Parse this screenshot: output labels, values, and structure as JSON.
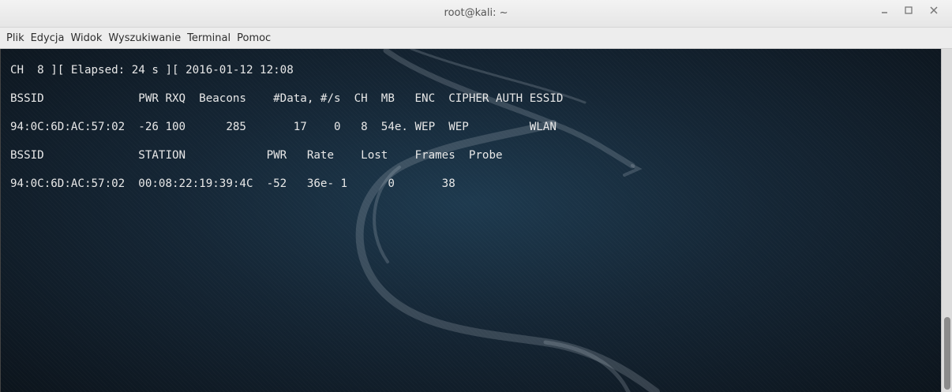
{
  "window": {
    "title": "root@kali: ~"
  },
  "menu": {
    "items": [
      "Plik",
      "Edycja",
      "Widok",
      "Wyszukiwanie",
      "Terminal",
      "Pomoc"
    ]
  },
  "terminal": {
    "lines": [
      "CH  8 ][ Elapsed: 24 s ][ 2016-01-12 12:08",
      "BSSID              PWR RXQ  Beacons    #Data, #/s  CH  MB   ENC  CIPHER AUTH ESSID",
      "94:0C:6D:AC:57:02  -26 100      285       17    0   8  54e. WEP  WEP         WLAN",
      "BSSID              STATION            PWR   Rate    Lost    Frames  Probe",
      "94:0C:6D:AC:57:02  00:08:22:19:39:4C  -52   36e- 1      0       38"
    ]
  },
  "icons": {
    "minimize": "minimize-icon",
    "maximize": "maximize-icon",
    "close": "close-icon"
  },
  "colors": {
    "terminal_text": "#e8e8e8",
    "terminal_bg": "#152635"
  }
}
